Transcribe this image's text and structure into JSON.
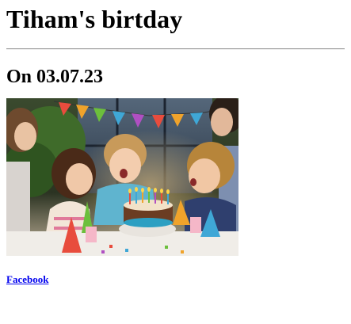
{
  "page": {
    "title": "Tiham's birtday",
    "date_heading": "On 03.07.23",
    "photo_subject": "children-birthday-party-photo",
    "links": {
      "facebook_label": "Facebook"
    }
  },
  "colors": {
    "link": "#0000ee",
    "text": "#000000",
    "divider": "#9a9a9a"
  }
}
